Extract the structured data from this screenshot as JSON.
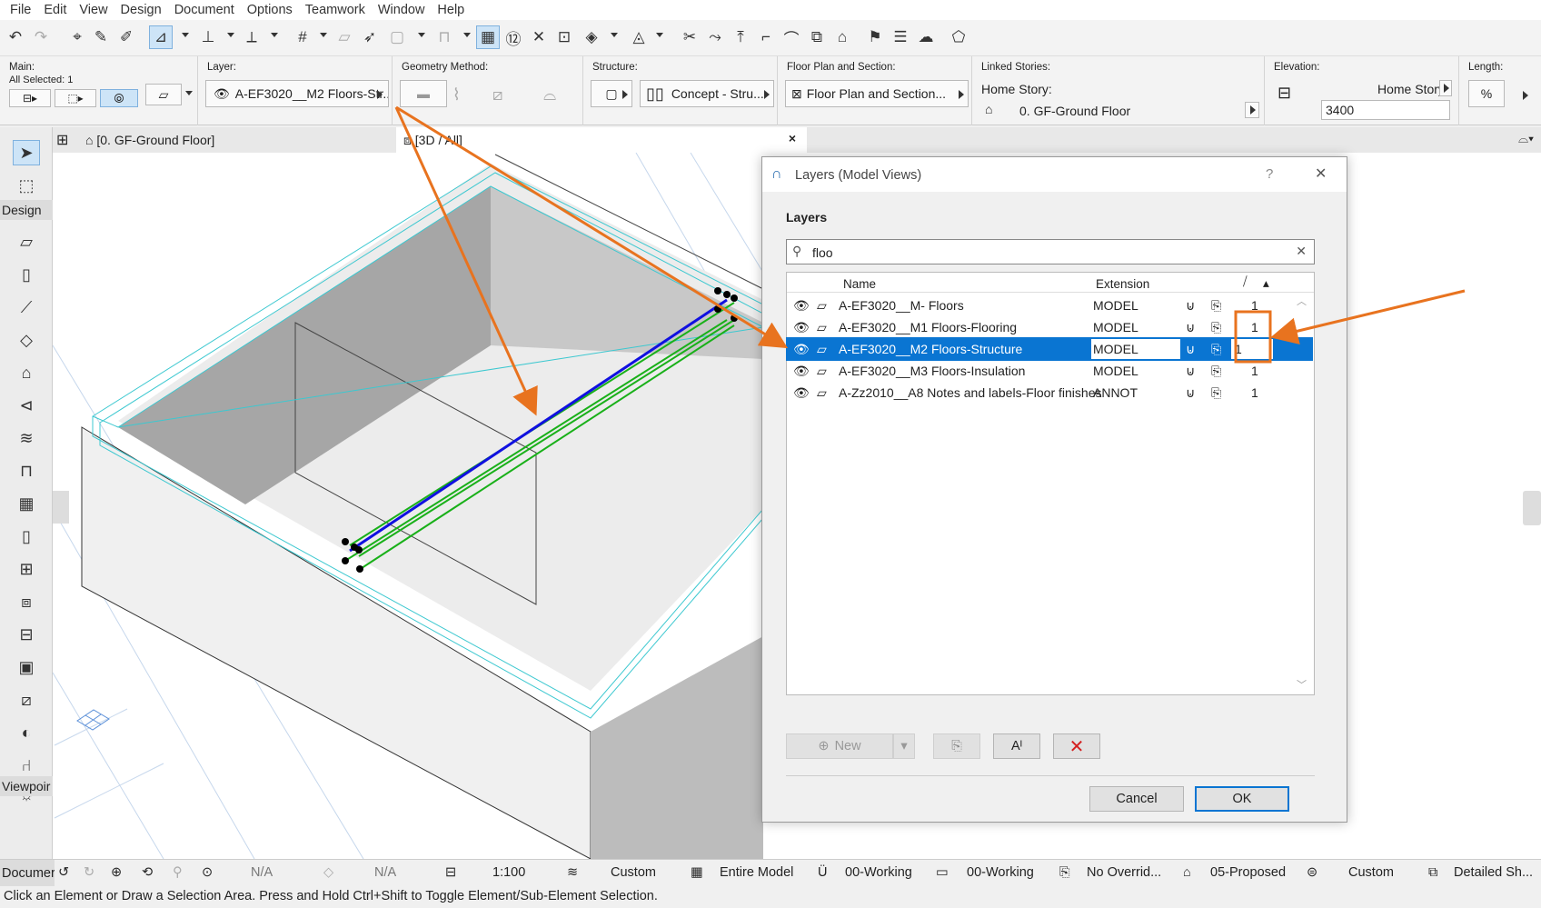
{
  "menu": [
    "File",
    "Edit",
    "View",
    "Design",
    "Document",
    "Options",
    "Teamwork",
    "Window",
    "Help"
  ],
  "infobox": {
    "main": {
      "title": "Main:",
      "selected": "All Selected: 1"
    },
    "layer": {
      "title": "Layer:",
      "value": "A-EF3020__M2 Floors-Str..."
    },
    "geometry": {
      "title": "Geometry Method:"
    },
    "structure": {
      "title": "Structure:",
      "value": "Concept - Stru..."
    },
    "floorplan": {
      "title": "Floor Plan and Section:",
      "value": "Floor Plan and Section..."
    },
    "linked": {
      "title": "Linked Stories:",
      "home": "Home Story:",
      "story": "0. GF-Ground Floor"
    },
    "elevation": {
      "title": "Elevation:",
      "home": "Home Story",
      "value": "3400"
    },
    "length": {
      "title": "Length:"
    }
  },
  "tabs": {
    "floor": "[0. GF-Ground Floor]",
    "view3d": "[3D / All]",
    "close": "×"
  },
  "toolbox": {
    "design": "Design",
    "viewpoint": "Viewpoir",
    "document": "Documer"
  },
  "dialog": {
    "title": "Layers (Model Views)",
    "help": "?",
    "close": "✕",
    "section": "Layers",
    "search": "floo",
    "columns": {
      "name": "Name",
      "extension": "Extension"
    },
    "rows": [
      {
        "name": "A-EF3020__M- Floors",
        "ext": "MODEL",
        "num": "1"
      },
      {
        "name": "A-EF3020__M1 Floors-Flooring",
        "ext": "MODEL",
        "num": "1"
      },
      {
        "name": "A-EF3020__M2 Floors-Structure",
        "ext": "MODEL",
        "num": "1"
      },
      {
        "name": "A-EF3020__M3 Floors-Insulation",
        "ext": "MODEL",
        "num": "1"
      },
      {
        "name": "A-Zz2010__A8 Notes and labels-Floor finishes",
        "ext": "ANNOT",
        "num": "1"
      }
    ],
    "new": "New",
    "cancel": "Cancel",
    "ok": "OK"
  },
  "status": {
    "na1": "N/A",
    "na2": "N/A",
    "scale": "1:100",
    "custom1": "Custom",
    "model": "Entire Model",
    "working1": "00-Working",
    "working2": "00-Working",
    "override": "No Overrid...",
    "proposed": "05-Proposed",
    "custom2": "Custom",
    "detailed": "Detailed Sh..."
  },
  "footer": "Click an Element or Draw a Selection Area. Press and Hold Ctrl+Shift to Toggle Element/Sub-Element Selection.",
  "colors": {
    "selection": "#0a75d2",
    "annotation": "#e8731f",
    "blue_line": "#1010e0",
    "green_line": "#19b019",
    "cyan_line": "#3cc8d0"
  }
}
